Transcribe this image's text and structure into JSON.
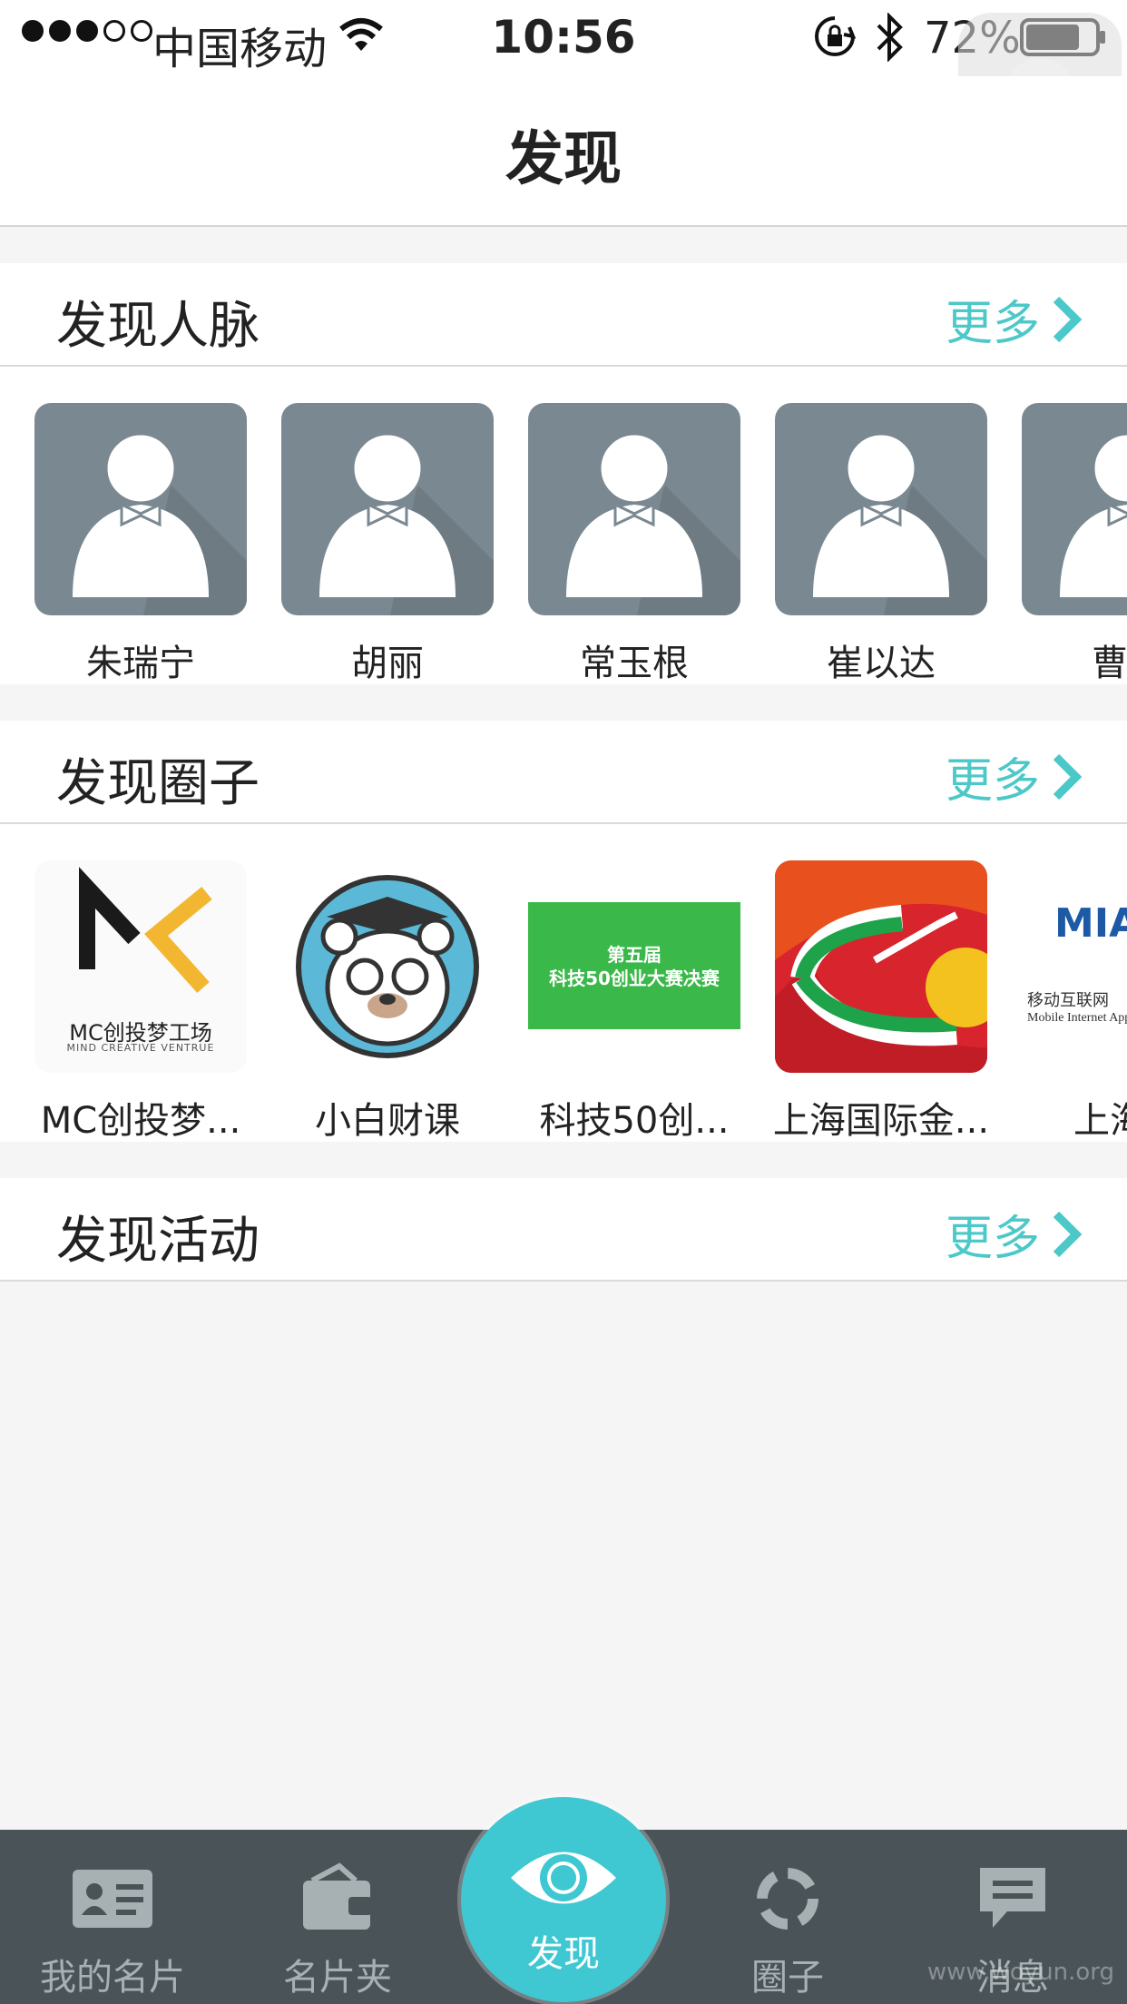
{
  "status_bar": {
    "carrier": "中国移动",
    "time": "10:56",
    "battery": "72%"
  },
  "nav": {
    "title": "发现"
  },
  "sections": {
    "people": {
      "title": "发现人脉",
      "more": "更多",
      "items": [
        {
          "name": "朱瑞宁"
        },
        {
          "name": "胡丽"
        },
        {
          "name": "常玉根"
        },
        {
          "name": "崔以达"
        },
        {
          "name": "曹仁"
        }
      ]
    },
    "circles": {
      "title": "发现圈子",
      "more": "更多",
      "items": [
        {
          "name": "MC创投梦...",
          "logo_text": "MC创投梦工场",
          "logo_sub": "MIND CREATIVE VENTRUE"
        },
        {
          "name": "小白财课"
        },
        {
          "name": "科技50创...",
          "logo_text": "第五届",
          "logo_sub": "科技50创业大赛决赛"
        },
        {
          "name": "上海国际金..."
        },
        {
          "name": "上海移",
          "logo_text": "MIAU",
          "logo_sub": "移动互联网",
          "logo_sub2": "Mobile Internet Appli"
        }
      ]
    },
    "events": {
      "title": "发现活动",
      "more": "更多"
    }
  },
  "tab_bar": {
    "tabs": [
      {
        "label": "我的名片",
        "icon": "id-card-icon"
      },
      {
        "label": "名片夹",
        "icon": "wallet-icon"
      },
      {
        "label": "发现",
        "icon": "eye-icon"
      },
      {
        "label": "圈子",
        "icon": "circle-arrows-icon"
      },
      {
        "label": "消息",
        "icon": "chat-bubble-icon"
      }
    ],
    "active_color": "#3fc7d2"
  },
  "watermark": "www.woyun.org",
  "colors": {
    "accent": "#4cc8c8",
    "tab_bar_bg": "#4a5458",
    "avatar_bg": "#7a8891"
  }
}
